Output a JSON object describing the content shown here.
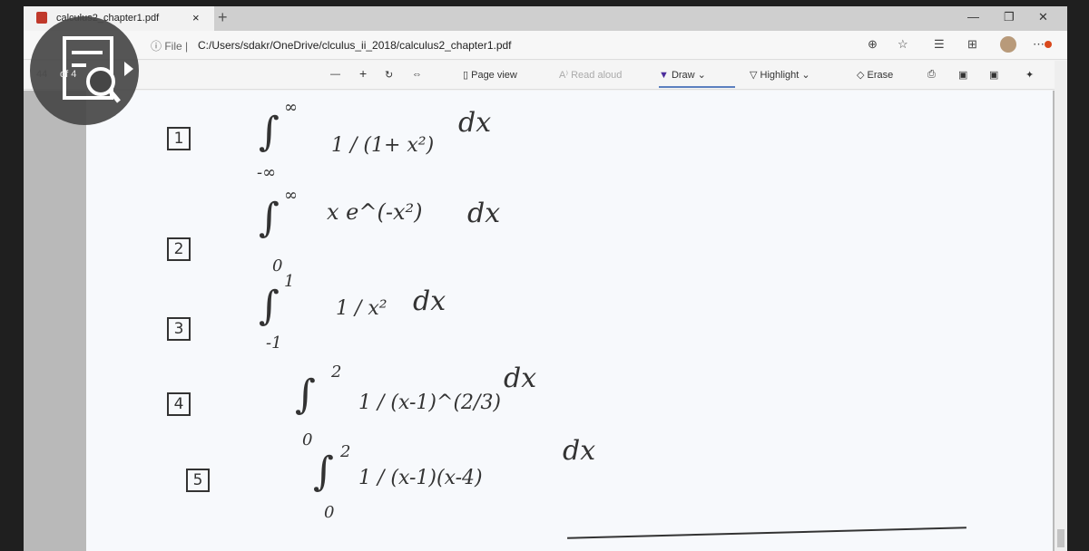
{
  "tab": {
    "title": "calculus2_chapter1.pdf",
    "close": "×",
    "new": "+"
  },
  "window": {
    "minimize": "—",
    "restore": "❐",
    "close": "✕"
  },
  "address": {
    "scheme": "File",
    "url": "C:/Users/sdakr/OneDrive/clculus_ii_2018/calculus2_chapter1.pdf"
  },
  "toolbar": {
    "page_current": "44",
    "page_total": "of 4",
    "zoom_out": "—",
    "zoom_in": "+",
    "page_view": "Page view",
    "read_aloud": "Read aloud",
    "draw": "Draw",
    "highlight": "Highlight",
    "erase": "Erase"
  },
  "problems": [
    {
      "n": "1",
      "lower": "-∞",
      "upper": "∞",
      "integrand": "1 / (1+ x²)",
      "dx": "dx"
    },
    {
      "n": "2",
      "lower": "0",
      "upper": "∞",
      "integrand": "x e^(-x²)",
      "dx": "dx"
    },
    {
      "n": "3",
      "lower": "-1",
      "upper": "1",
      "integrand": "1 / x²",
      "dx": "dx"
    },
    {
      "n": "4",
      "lower": "0",
      "upper": "2",
      "integrand": "1 / (x-1)^(2/3)",
      "dx": "dx"
    },
    {
      "n": "5",
      "lower": "0",
      "upper": "2",
      "integrand": "1 / (x-1)(x-4)",
      "dx": "dx"
    }
  ],
  "colors": {
    "draw_accent": "#4b2c9c",
    "notification": "#d9481c"
  }
}
